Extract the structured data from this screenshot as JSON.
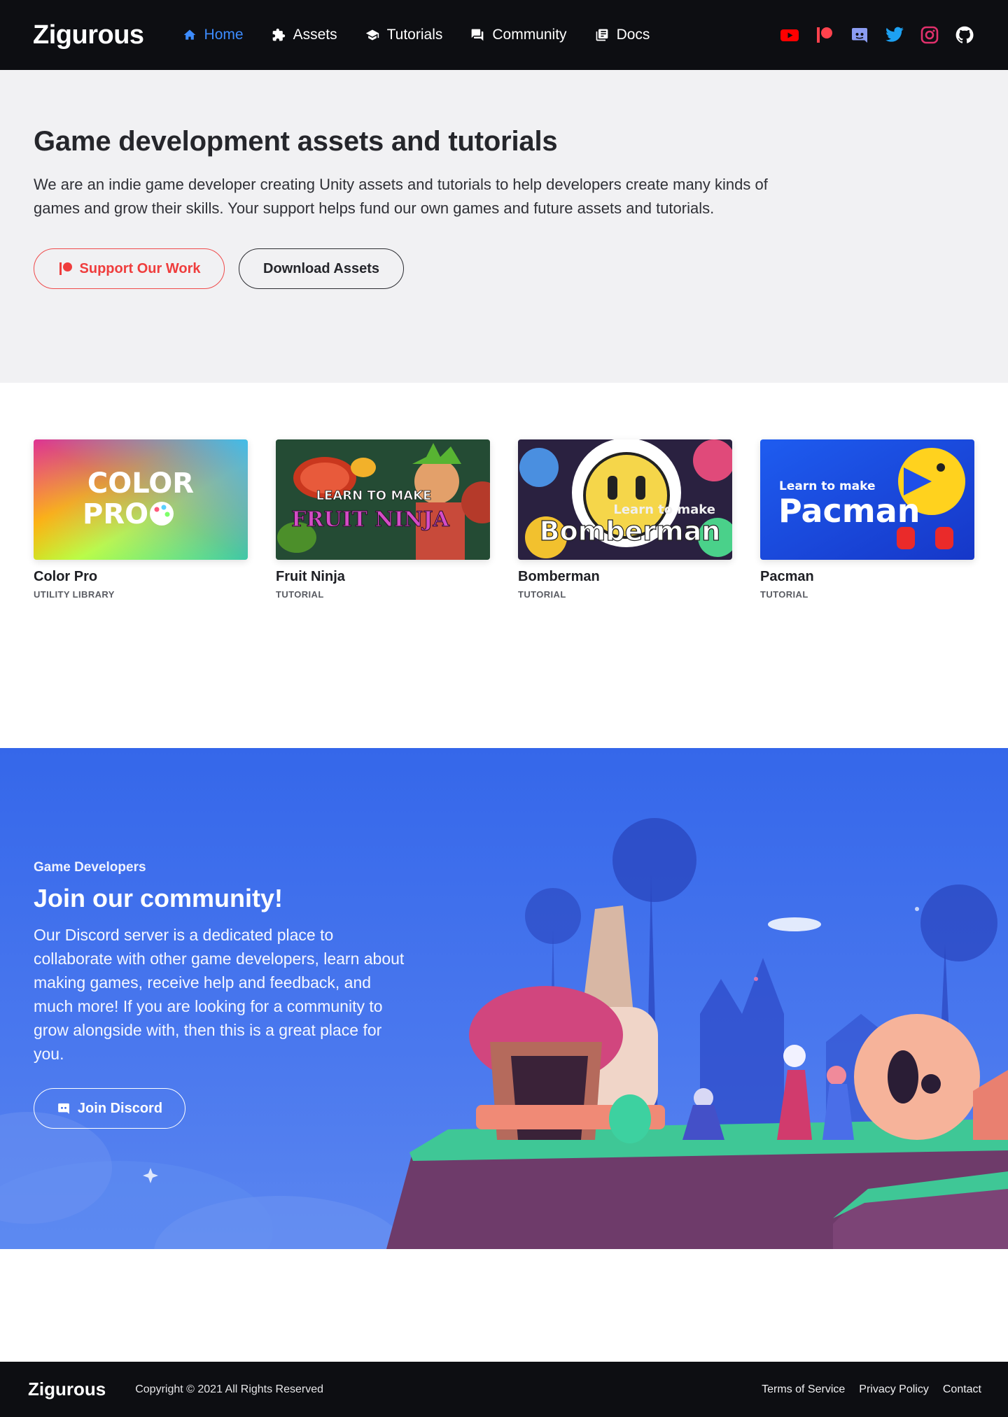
{
  "nav": {
    "brand": "Zigurous",
    "items": [
      {
        "label": "Home",
        "icon": "home-icon",
        "active": true
      },
      {
        "label": "Assets",
        "icon": "puzzle-icon"
      },
      {
        "label": "Tutorials",
        "icon": "graduation-cap-icon"
      },
      {
        "label": "Community",
        "icon": "chat-icon"
      },
      {
        "label": "Docs",
        "icon": "docs-icon"
      }
    ],
    "socials": [
      {
        "name": "youtube-icon",
        "color": "#ff0000"
      },
      {
        "name": "patreon-icon",
        "color": "#ff424d"
      },
      {
        "name": "discord-icon",
        "color": "#7289da"
      },
      {
        "name": "twitter-icon",
        "color": "#1da1f2"
      },
      {
        "name": "instagram-icon",
        "color": "#e1306c"
      },
      {
        "name": "github-icon",
        "color": "#ffffff"
      }
    ],
    "active_color": "#3d8cff"
  },
  "hero": {
    "title": "Game development assets and tutorials",
    "description": "We are an indie game developer creating Unity assets and tutorials to help developers create many kinds of games and grow their skills. Your support helps fund our own games and future assets and tutorials.",
    "support_label": "Support Our Work",
    "download_label": "Download Assets",
    "support_color": "#ef3d3d"
  },
  "cards": [
    {
      "title": "Color Pro",
      "subtitle": "UTILITY LIBRARY",
      "art_text": [
        "COLOR",
        "PRO"
      ]
    },
    {
      "title": "Fruit Ninja",
      "subtitle": "TUTORIAL",
      "art_text": [
        "LEARN TO MAKE",
        "FRUIT NINJA"
      ]
    },
    {
      "title": "Bomberman",
      "subtitle": "TUTORIAL",
      "art_text": [
        "Learn to make",
        "Bomberman"
      ]
    },
    {
      "title": "Pacman",
      "subtitle": "TUTORIAL",
      "art_text": [
        "Learn to make",
        "Pacman"
      ]
    }
  ],
  "community": {
    "eyebrow": "Game Developers",
    "title": "Join our community!",
    "description": "Our Discord server is a dedicated place to collaborate with other game developers, learn about making games, receive help and feedback, and much more! If you are looking for a community to grow alongside with, then this is a great place for you.",
    "button_label": "Join Discord",
    "background_color": "#3567ea"
  },
  "footer": {
    "brand": "Zigurous",
    "copyright": "Copyright © 2021 All Rights Reserved",
    "links": [
      "Terms of Service",
      "Privacy Policy",
      "Contact"
    ]
  }
}
